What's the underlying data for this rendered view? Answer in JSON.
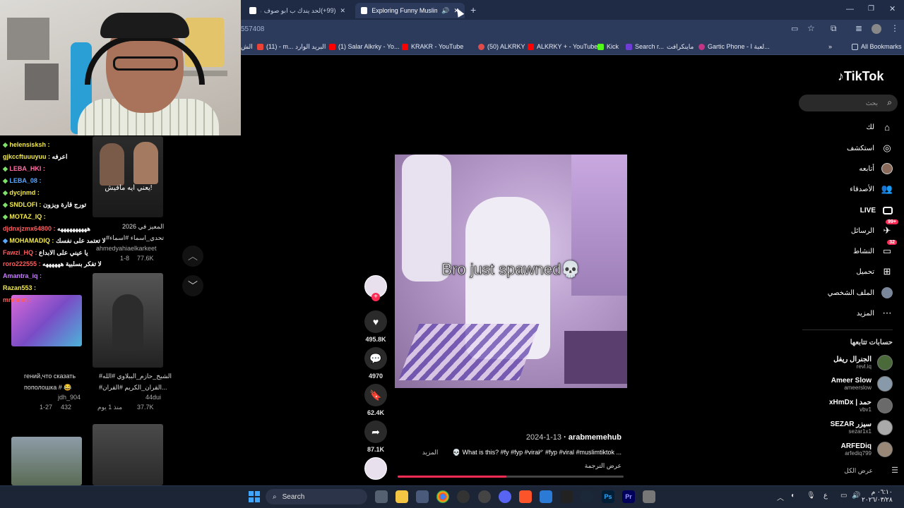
{
  "browser": {
    "tabs": [
      {
        "label": "(99+)لحد يندك ب ابو صوف 🔥🔥",
        "active": false
      },
      {
        "label": "Exploring Funny Muslim an",
        "active": true
      }
    ],
    "new_tab": "+",
    "address": "557408",
    "bookmarks": [
      "الش",
      "(11) - m...",
      "البريد الوارد",
      "(1) Salar Alkrky - Yo...",
      "KRAKR - YouTube",
      "(50) ALKRKY",
      "ALKRKY + - YouTube",
      "Kick",
      "Search r...",
      "ماينكرافت",
      "Gartic Phone - لعبة ا..."
    ],
    "all_bookmarks": "All Bookmarks"
  },
  "chat": [
    {
      "user": "helensisksh :",
      "msg": "",
      "color": "#f2e94e"
    },
    {
      "user": "gjkccftuuuyuu :",
      "msg": "اعرفه",
      "color": "#f2e94e"
    },
    {
      "user": "LEBA_HKI :",
      "msg": "",
      "color": "#ff6fa8"
    },
    {
      "user": "LEBA_08 :",
      "msg": "",
      "color": "#5aa8ff"
    },
    {
      "user": "dycjnmd :",
      "msg": "",
      "color": "#f2e94e"
    },
    {
      "user": "SNDLOFI :",
      "msg": "تورج قارة ويزون",
      "color": "#f2e94e"
    },
    {
      "user": "MOTAZ_IQ :",
      "msg": "",
      "color": "#f2e94e"
    },
    {
      "user": "djdnxjzmx64800 :",
      "msg": "ههههههههههه",
      "color": "#ff5c5c"
    },
    {
      "user": "MOHAMADIQ :",
      "msg": "لا تعتمد على نفسك",
      "color": "#f2e94e"
    },
    {
      "user": "Fawzi_HQ :",
      "msg": "يا عيني على الابداع",
      "color": "#ff5c5c"
    },
    {
      "user": "roro222555 :",
      "msg": "لا تفكر بسلبية ههههههه",
      "color": "#ff5c5c"
    },
    {
      "user": "Amantra_iq :",
      "msg": "",
      "color": "#c77dff"
    },
    {
      "user": "Razan553 :",
      "msg": "",
      "color": "#f2e94e"
    },
    {
      "user": "mnmnm :",
      "msg": "",
      "color": "#ff5c5c"
    }
  ],
  "grid": [
    {
      "overlay": "يعني ايه مافيش!",
      "title": "المعيز في 2026",
      "tag": "#تحدي_اسماء #اسماء",
      "author": "ahmedyahiaelkarkeet",
      "date": "1-8",
      "views": "77.6K"
    },
    {
      "title": "#الشيخ_حازم_الببلاوي #الله",
      "tag": "#القران_الكريم #القران...",
      "author": "44dui",
      "date": "منذ 1 يوم",
      "views": "37.7K"
    },
    {
      "title": "гений,что сказать",
      "tag": "пополошка # 😂",
      "author": "jdh_904",
      "date": "1-27",
      "views": "432"
    }
  ],
  "video": {
    "caption": "Bro just spawned💀",
    "likes": "495.8K",
    "comments": "4970",
    "saves": "62.4K",
    "shares": "87.1K",
    "author": "arabmemehub",
    "date": "2024-1-13",
    "description": "💀 What is this? #fy #fyp #viral⁄ᐟ #fyp #viral #muslimtiktok ...",
    "more": "المزيد",
    "translate": "عرض الترجمة",
    "progress": 0.48
  },
  "sidebar": {
    "logo": "TikTok",
    "search_placeholder": "بحث",
    "nav": [
      {
        "label": "لك",
        "icon": "home-icon",
        "glyph": "⌂"
      },
      {
        "label": "استكشف",
        "icon": "compass-icon",
        "glyph": "◎"
      },
      {
        "label": "LIVE",
        "icon": "live-icon",
        "glyph": ""
      },
      {
        "label": "أتابعه",
        "icon": "following-icon",
        "glyph": ""
      },
      {
        "label": "الأصدقاء",
        "icon": "friends-icon",
        "glyph": "👥"
      },
      {
        "label": "الرسائل",
        "icon": "messages-icon",
        "glyph": "✈",
        "badge": "99+"
      },
      {
        "label": "النشاط",
        "icon": "activity-icon",
        "glyph": "▭",
        "badge": "32"
      },
      {
        "label": "تحميل",
        "icon": "upload-icon",
        "glyph": "⊞"
      },
      {
        "label": "الملف الشخصي",
        "icon": "profile-icon",
        "glyph": ""
      },
      {
        "label": "المزيد",
        "icon": "more-icon",
        "glyph": "⋯"
      }
    ],
    "following_title": "حسابات تتابعها",
    "following": [
      {
        "name": "الجنرال ريفل",
        "handle": "revl.iq"
      },
      {
        "name": "Ameer Slow",
        "handle": "ameerslow"
      },
      {
        "name": "xHmDx | حمد",
        "handle": "vbv1"
      },
      {
        "name": "SEZAR سيزر",
        "handle": "sezar1x1"
      },
      {
        "name": "ARFEDiq",
        "handle": "arfediq799"
      }
    ],
    "see_all": "عرض الكل"
  },
  "taskbar": {
    "search_label": "Search",
    "time": "٠٦:١٠ م",
    "date": "٢٠٢٦/٠٣/٢٨",
    "lang": "ع"
  }
}
